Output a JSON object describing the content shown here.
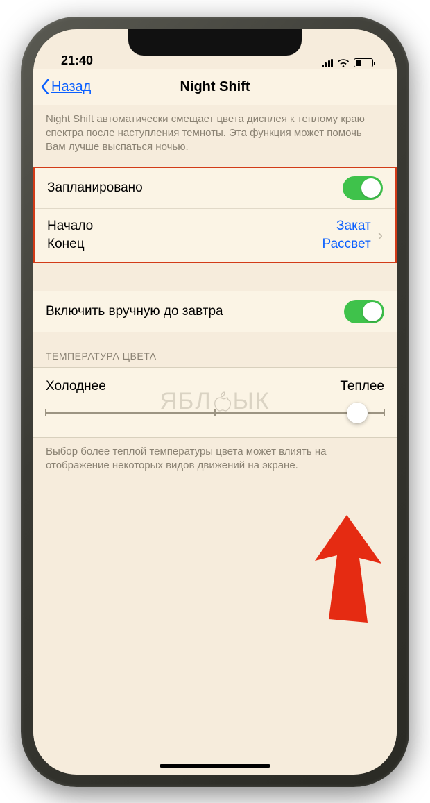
{
  "status": {
    "time": "21:40"
  },
  "nav": {
    "back_label": "Назад",
    "title": "Night Shift"
  },
  "intro_text": "Night Shift автоматически смещает цвета дисплея к теплому краю спектра после наступления темноты. Эта функция может помочь Вам лучше выспаться ночью.",
  "schedule": {
    "scheduled_label": "Запланировано",
    "scheduled_on": true,
    "start_label": "Начало",
    "end_label": "Конец",
    "start_value": "Закат",
    "end_value": "Рассвет"
  },
  "manual": {
    "label": "Включить вручную до завтра",
    "on": true
  },
  "section_header": "ТЕМПЕРАТУРА ЦВЕТА",
  "slider": {
    "left_label": "Холоднее",
    "right_label": "Теплее",
    "value_percent": 92
  },
  "slider_footer": "Выбор более теплой температуры цвета может влиять на отображение некоторых видов движений на экране.",
  "watermark": [
    "ЯБЛ",
    "ЫК"
  ]
}
